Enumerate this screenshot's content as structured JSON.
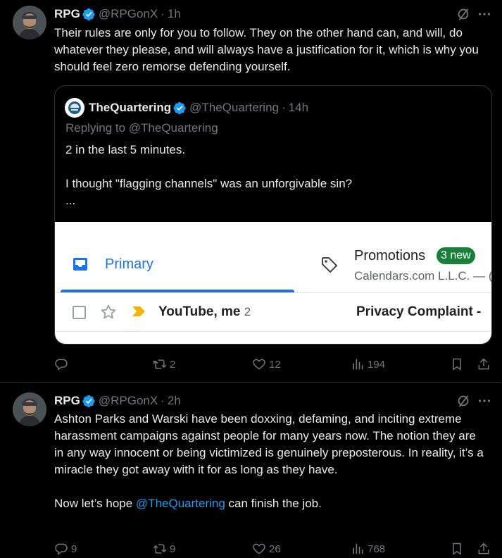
{
  "tweets": [
    {
      "author_name": "RPG",
      "handle": "@RPGonX",
      "separator": "·",
      "time": "1h",
      "text": "Their rules are only for you to follow. They  on the other hand can, and will, do whatever they please, and will always have a justification for it, which is why you should feel zero remorse defending yourself.",
      "quote": {
        "author_name": "TheQuartering",
        "handle": "@TheQuartering",
        "separator": "·",
        "time": "14h",
        "replying_to": "Replying to @TheQuartering",
        "line1": "2 in the last 5 minutes.",
        "line2": "I thought \"flagging channels\" was an unforgivable sin?",
        "line3": "...",
        "gmail": {
          "primary_tab": "Primary",
          "promotions_tab": "Promotions",
          "promotions_badge": "3 new",
          "promotions_sub": "Calendars.com L.L.C. — (e",
          "sender": "YouTube, me",
          "sender_count": "2",
          "subject": "Privacy Complaint -"
        }
      },
      "stats": {
        "replies": "",
        "retweets": "2",
        "likes": "12",
        "views": "194"
      }
    },
    {
      "author_name": "RPG",
      "handle": "@RPGonX",
      "separator": "·",
      "time": "2h",
      "text_p1": "Ashton Parks and Warski have been doxxing, defaming, and inciting extreme harassment campaigns against people for many years now. The notion they are in any way innocent or being victimized is genuinely preposterous. In reality, it’s a miracle they got away with it for as long as they have.",
      "text_p2_before": "Now let’s hope ",
      "text_p2_mention": "@TheQuartering",
      "text_p2_after": " can finish the job.",
      "stats": {
        "replies": "9",
        "retweets": "9",
        "likes": "26",
        "views": "768"
      }
    }
  ],
  "colors": {
    "accent": "#1d9bf0",
    "muted": "#71767b",
    "text": "#e7e9ea",
    "divider": "#2f3336",
    "gmail_blue": "#1a73e8",
    "gmail_badge": "#188038"
  }
}
